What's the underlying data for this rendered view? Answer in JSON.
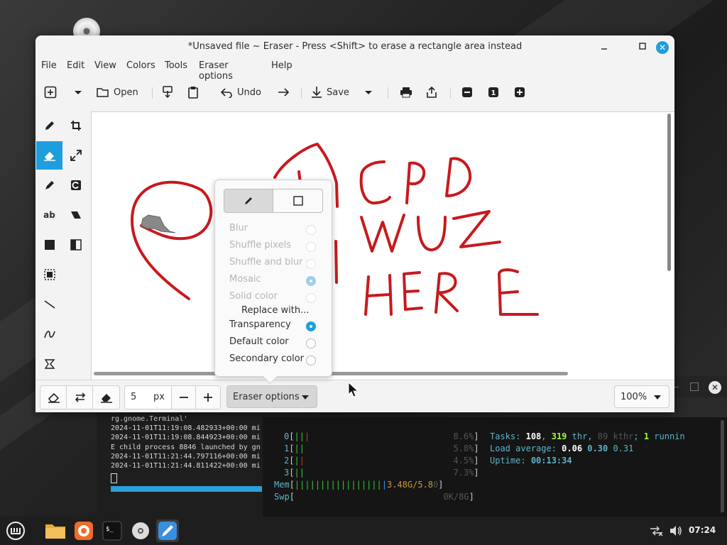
{
  "window": {
    "title": "*Unsaved file ~ Eraser - Press <Shift> to erase a rectangle area instead",
    "min_icon": "minimize-icon",
    "max_icon": "maximize-icon",
    "close_icon": "close-icon"
  },
  "menu": [
    "File",
    "Edit",
    "View",
    "Colors",
    "Tools",
    "Eraser options",
    "Help"
  ],
  "toolbar": {
    "open_label": "Open",
    "undo_label": "Undo",
    "save_label": "Save",
    "zoom_badge": "1"
  },
  "tools": [
    {
      "name": "pencil-icon"
    },
    {
      "name": "crop-icon"
    },
    {
      "name": "eraser-icon",
      "active": true
    },
    {
      "name": "scale-icon"
    },
    {
      "name": "highlighter-icon"
    },
    {
      "name": "rotate-icon"
    },
    {
      "name": "text-icon",
      "label": "ab"
    },
    {
      "name": "filters-icon"
    },
    {
      "name": "rectangle-icon"
    },
    {
      "name": "skew-icon"
    },
    {
      "name": "selection-icon"
    },
    {
      "name": "line-icon"
    },
    {
      "name": "curve-icon"
    },
    {
      "name": "free-shape-icon"
    }
  ],
  "bottom": {
    "size_value": "5",
    "size_unit": "px",
    "eraser_options_label": "Eraser options",
    "zoom_value": "100%"
  },
  "popover": {
    "options": [
      {
        "label": "Blur",
        "disabled": true,
        "selected": false
      },
      {
        "label": "Shuffle pixels",
        "disabled": true,
        "selected": false
      },
      {
        "label": "Shuffle and blur",
        "disabled": true,
        "selected": false
      },
      {
        "label": "Mosaic",
        "disabled": true,
        "selected": true
      },
      {
        "label": "Solid color",
        "disabled": true,
        "selected": false
      }
    ],
    "replace_heading": "Replace with...",
    "replace_options": [
      {
        "label": "Transparency",
        "selected": true
      },
      {
        "label": "Default color",
        "selected": false
      },
      {
        "label": "Secondary color",
        "selected": false
      }
    ]
  },
  "canvas_text": [
    "CPD",
    "WUZ",
    "HERE"
  ],
  "terminal": {
    "log_lines": [
      "rg.gnome.Terminal'",
      "2024-11-01T11:19:08.482933+00:00 mi",
      "2024-11-01T11:19:08.844923+00:00 mi",
      "E child process 8846 launched by gn",
      "2024-11-01T11:21:44.797116+00:00 mi",
      "2024-11-01T11:21:44.811422+00:00 mi"
    ],
    "htop": {
      "cpu": [
        {
          "id": "0",
          "pct": "8.6%"
        },
        {
          "id": "1",
          "pct": "5.8%"
        },
        {
          "id": "2",
          "pct": "4.5%"
        },
        {
          "id": "3",
          "pct": "7.3%"
        }
      ],
      "mem": "3.48G/5.8",
      "swp": "0K/8G",
      "tasks_label": "Tasks:",
      "tasks": "108",
      "thr": "319",
      "kthr": "89",
      "running": "1",
      "load_label": "Load average:",
      "load": [
        "0.06",
        "0.30",
        "0.31"
      ],
      "uptime_label": "Uptime:",
      "uptime": "00:13:34"
    }
  },
  "taskbar": {
    "apps": [
      "menu-icon",
      "files-icon",
      "firefox-icon",
      "terminal-icon",
      "disc-icon",
      "drawing-icon"
    ],
    "clock": "07:24"
  }
}
